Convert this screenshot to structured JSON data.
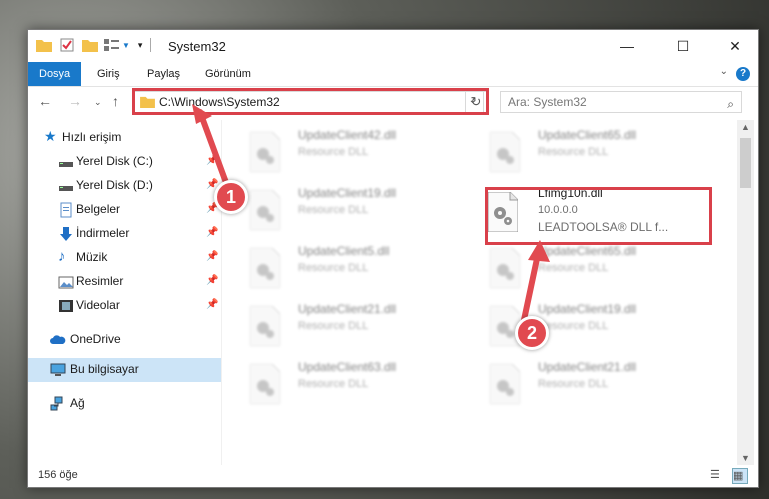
{
  "window": {
    "title": "System32",
    "controls": {
      "minimize": "—",
      "maximize": "☐",
      "close": "✕"
    }
  },
  "ribbon": {
    "tabs": [
      "Dosya",
      "Giriş",
      "Paylaş",
      "Görünüm"
    ],
    "active_tab": "Dosya",
    "help_label": "?"
  },
  "nav": {
    "address": "C:\\Windows\\System32",
    "search_placeholder": "Ara: System32"
  },
  "sidebar": {
    "items": [
      {
        "label": "Hızlı erişim",
        "icon": "star-icon",
        "pinned": false
      },
      {
        "label": "Yerel Disk (C:)",
        "icon": "drive-icon",
        "pinned": true
      },
      {
        "label": "Yerel Disk (D:)",
        "icon": "drive-icon",
        "pinned": true
      },
      {
        "label": "Belgeler",
        "icon": "documents-icon",
        "pinned": true
      },
      {
        "label": "İndirmeler",
        "icon": "download-icon",
        "pinned": true
      },
      {
        "label": "Müzik",
        "icon": "music-icon",
        "pinned": true
      },
      {
        "label": "Resimler",
        "icon": "pictures-icon",
        "pinned": true
      },
      {
        "label": "Videolar",
        "icon": "videos-icon",
        "pinned": true
      },
      {
        "label": "OneDrive",
        "icon": "cloud-icon",
        "pinned": false
      },
      {
        "label": "Bu bilgisayar",
        "icon": "computer-icon",
        "pinned": false,
        "selected": true
      },
      {
        "label": "Ağ",
        "icon": "network-icon",
        "pinned": false
      }
    ]
  },
  "files": {
    "left": [
      {
        "name": "UpdateClient42.dll",
        "type": "Resource DLL"
      },
      {
        "name": "UpdateClient19.dll",
        "type": "Resource DLL"
      },
      {
        "name": "UpdateClient5.dll",
        "type": "Resource DLL"
      },
      {
        "name": "UpdateClient21.dll",
        "type": "Resource DLL"
      },
      {
        "name": "UpdateClient63.dll",
        "type": "Resource DLL"
      }
    ],
    "right": [
      {
        "name": "UpdateClient65.dll",
        "type": "Resource DLL"
      },
      {
        "name": "Lfimg10n.dll",
        "version": "10.0.0.0",
        "type": "LEADTOOLSA® DLL f...",
        "focused": true
      },
      {
        "name": "UpdateClient65.dll",
        "type": "Resource DLL"
      },
      {
        "name": "UpdateClient19.dll",
        "type": "Resource DLL"
      },
      {
        "name": "UpdateClient21.dll",
        "type": "Resource DLL"
      }
    ]
  },
  "status": {
    "count": "156 öğe"
  },
  "annotations": {
    "badge1": "1",
    "badge2": "2"
  },
  "colors": {
    "accent": "#1979ca",
    "highlight": "#d9404a",
    "badge": "#e14a50",
    "selected": "#cce4f7"
  }
}
